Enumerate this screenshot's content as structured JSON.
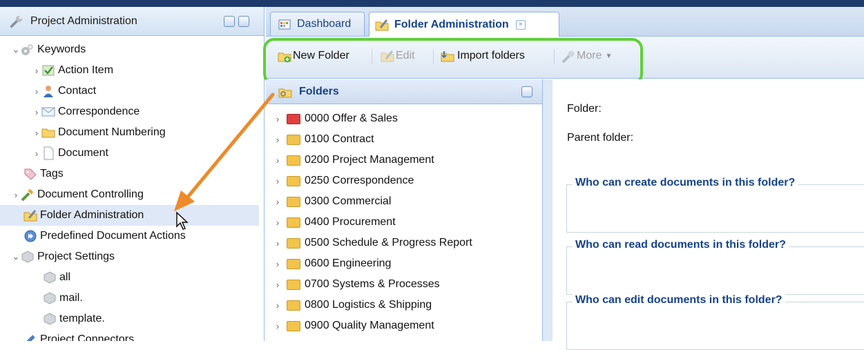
{
  "left_panel": {
    "title": "Project Administration",
    "tree": [
      {
        "label": "Keywords"
      },
      {
        "label": "Action Item"
      },
      {
        "label": "Contact"
      },
      {
        "label": "Correspondence"
      },
      {
        "label": "Document Numbering"
      },
      {
        "label": "Document"
      },
      {
        "label": "Tags"
      },
      {
        "label": "Document Controlling"
      },
      {
        "label": "Folder Administration"
      },
      {
        "label": "Predefined Document Actions"
      },
      {
        "label": "Project Settings"
      },
      {
        "label": "all"
      },
      {
        "label": "mail."
      },
      {
        "label": "template."
      },
      {
        "label": "Project Connectors"
      }
    ]
  },
  "tabs": [
    {
      "label": "Dashboard"
    },
    {
      "label": "Folder Administration"
    }
  ],
  "toolbar": {
    "new_folder": "New Folder",
    "edit": "Edit",
    "import_folders": "Import folders",
    "more": "More"
  },
  "folders_panel": {
    "title": "Folders",
    "items": [
      {
        "label": "0000 Offer & Sales",
        "color": "#e0403f"
      },
      {
        "label": "0100 Contract",
        "color": "#f3c34a"
      },
      {
        "label": "0200 Project Management",
        "color": "#f3c34a"
      },
      {
        "label": "0250 Correspondence",
        "color": "#f3c34a"
      },
      {
        "label": "0300 Commercial",
        "color": "#f3c34a"
      },
      {
        "label": "0400 Procurement",
        "color": "#f3c34a"
      },
      {
        "label": "0500 Schedule & Progress Report",
        "color": "#f3c34a"
      },
      {
        "label": "0600 Engineering",
        "color": "#f3c34a"
      },
      {
        "label": "0700 Systems & Processes",
        "color": "#f3c34a"
      },
      {
        "label": "0800 Logistics & Shipping",
        "color": "#f3c34a"
      },
      {
        "label": "0900 Quality Management",
        "color": "#f3c34a"
      }
    ]
  },
  "form": {
    "folder_label": "Folder:",
    "parent_label": "Parent folder:",
    "create_legend": "Who can create documents in this folder?",
    "read_legend": "Who can read documents in this folder?",
    "edit_legend": "Who can edit documents in this folder?"
  },
  "colors": {
    "highlight": "#5fd037",
    "annotation_arrow": "#ee8a2a",
    "accent": "#15428b"
  }
}
